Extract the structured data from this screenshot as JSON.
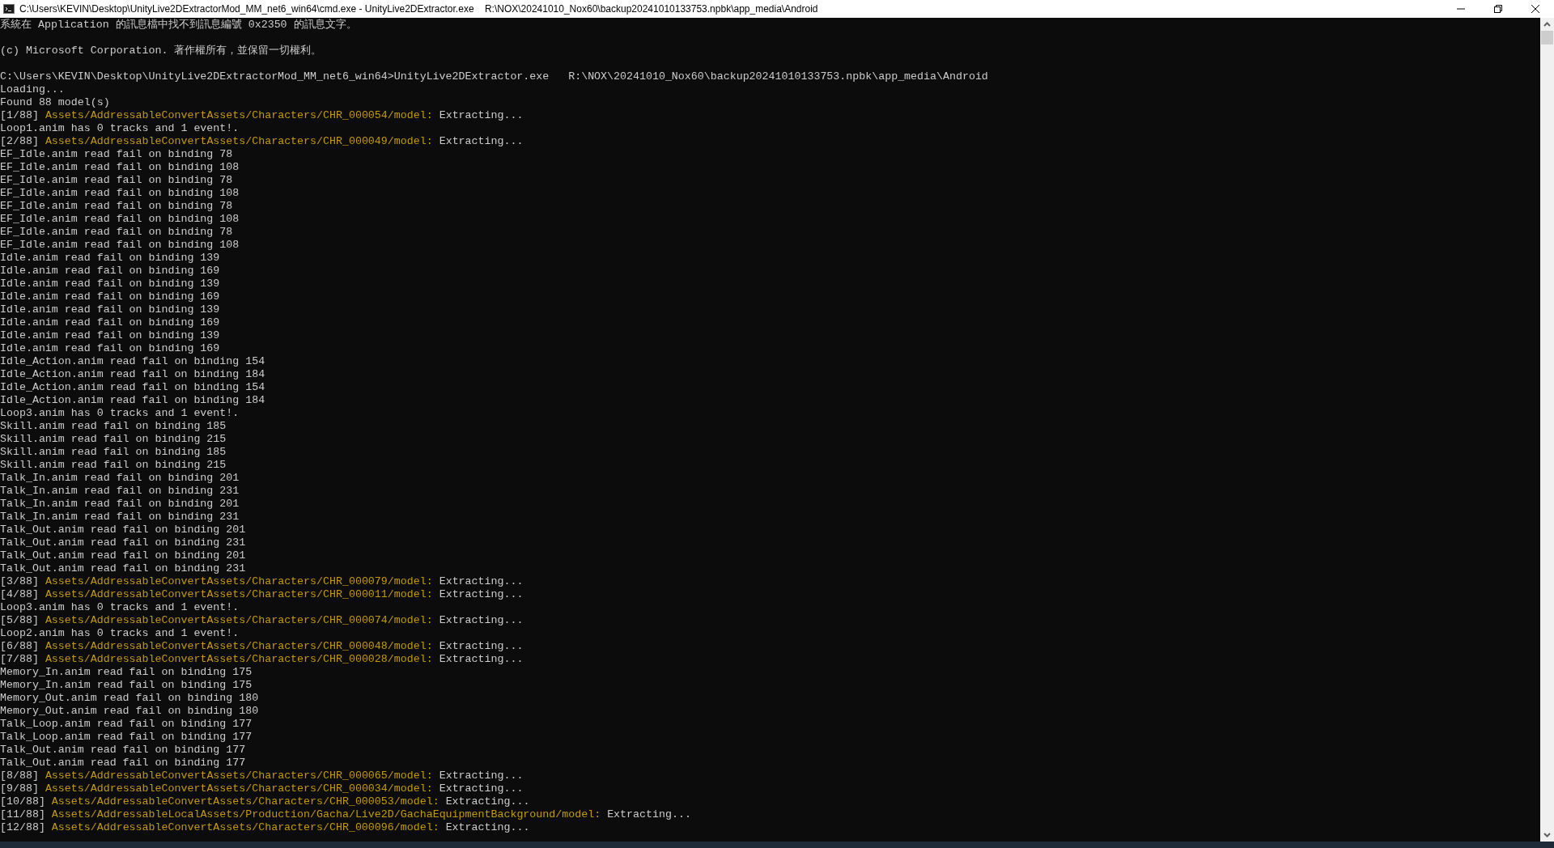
{
  "window": {
    "title": "C:\\Users\\KEVIN\\Desktop\\UnityLive2DExtractorMod_MM_net6_win64\\cmd.exe - UnityLive2DExtractor.exe    R:\\NOX\\20241010_Nox60\\backup20241010133753.npbk\\app_media\\Android"
  },
  "console": {
    "lines": [
      {
        "kind": "text",
        "text": "系統在 Application 的訊息檔中找不到訊息編號 0x2350 的訊息文字。"
      },
      {
        "kind": "blank"
      },
      {
        "kind": "text",
        "text": "(c) Microsoft Corporation. 著作權所有，並保留一切權利。"
      },
      {
        "kind": "blank"
      },
      {
        "kind": "text",
        "text": "C:\\Users\\KEVIN\\Desktop\\UnityLive2DExtractorMod_MM_net6_win64>UnityLive2DExtractor.exe   R:\\NOX\\20241010_Nox60\\backup20241010133753.npbk\\app_media\\Android"
      },
      {
        "kind": "text",
        "text": "Loading..."
      },
      {
        "kind": "text",
        "text": "Found 88 model(s)"
      },
      {
        "kind": "progress",
        "counter": "[1/88]",
        "path": "Assets/AddressableConvertAssets/Characters/CHR_000054/model:",
        "status": "Extracting..."
      },
      {
        "kind": "text",
        "text": "Loop1.anim has 0 tracks and 1 event!."
      },
      {
        "kind": "progress",
        "counter": "[2/88]",
        "path": "Assets/AddressableConvertAssets/Characters/CHR_000049/model:",
        "status": "Extracting..."
      },
      {
        "kind": "text",
        "text": "EF_Idle.anim read fail on binding 78"
      },
      {
        "kind": "text",
        "text": "EF_Idle.anim read fail on binding 108"
      },
      {
        "kind": "text",
        "text": "EF_Idle.anim read fail on binding 78"
      },
      {
        "kind": "text",
        "text": "EF_Idle.anim read fail on binding 108"
      },
      {
        "kind": "text",
        "text": "EF_Idle.anim read fail on binding 78"
      },
      {
        "kind": "text",
        "text": "EF_Idle.anim read fail on binding 108"
      },
      {
        "kind": "text",
        "text": "EF_Idle.anim read fail on binding 78"
      },
      {
        "kind": "text",
        "text": "EF_Idle.anim read fail on binding 108"
      },
      {
        "kind": "text",
        "text": "Idle.anim read fail on binding 139"
      },
      {
        "kind": "text",
        "text": "Idle.anim read fail on binding 169"
      },
      {
        "kind": "text",
        "text": "Idle.anim read fail on binding 139"
      },
      {
        "kind": "text",
        "text": "Idle.anim read fail on binding 169"
      },
      {
        "kind": "text",
        "text": "Idle.anim read fail on binding 139"
      },
      {
        "kind": "text",
        "text": "Idle.anim read fail on binding 169"
      },
      {
        "kind": "text",
        "text": "Idle.anim read fail on binding 139"
      },
      {
        "kind": "text",
        "text": "Idle.anim read fail on binding 169"
      },
      {
        "kind": "text",
        "text": "Idle_Action.anim read fail on binding 154"
      },
      {
        "kind": "text",
        "text": "Idle_Action.anim read fail on binding 184"
      },
      {
        "kind": "text",
        "text": "Idle_Action.anim read fail on binding 154"
      },
      {
        "kind": "text",
        "text": "Idle_Action.anim read fail on binding 184"
      },
      {
        "kind": "text",
        "text": "Loop3.anim has 0 tracks and 1 event!."
      },
      {
        "kind": "text",
        "text": "Skill.anim read fail on binding 185"
      },
      {
        "kind": "text",
        "text": "Skill.anim read fail on binding 215"
      },
      {
        "kind": "text",
        "text": "Skill.anim read fail on binding 185"
      },
      {
        "kind": "text",
        "text": "Skill.anim read fail on binding 215"
      },
      {
        "kind": "text",
        "text": "Talk_In.anim read fail on binding 201"
      },
      {
        "kind": "text",
        "text": "Talk_In.anim read fail on binding 231"
      },
      {
        "kind": "text",
        "text": "Talk_In.anim read fail on binding 201"
      },
      {
        "kind": "text",
        "text": "Talk_In.anim read fail on binding 231"
      },
      {
        "kind": "text",
        "text": "Talk_Out.anim read fail on binding 201"
      },
      {
        "kind": "text",
        "text": "Talk_Out.anim read fail on binding 231"
      },
      {
        "kind": "text",
        "text": "Talk_Out.anim read fail on binding 201"
      },
      {
        "kind": "text",
        "text": "Talk_Out.anim read fail on binding 231"
      },
      {
        "kind": "progress",
        "counter": "[3/88]",
        "path": "Assets/AddressableConvertAssets/Characters/CHR_000079/model:",
        "status": "Extracting..."
      },
      {
        "kind": "progress",
        "counter": "[4/88]",
        "path": "Assets/AddressableConvertAssets/Characters/CHR_000011/model:",
        "status": "Extracting..."
      },
      {
        "kind": "text",
        "text": "Loop3.anim has 0 tracks and 1 event!."
      },
      {
        "kind": "progress",
        "counter": "[5/88]",
        "path": "Assets/AddressableConvertAssets/Characters/CHR_000074/model:",
        "status": "Extracting..."
      },
      {
        "kind": "text",
        "text": "Loop2.anim has 0 tracks and 1 event!."
      },
      {
        "kind": "progress",
        "counter": "[6/88]",
        "path": "Assets/AddressableConvertAssets/Characters/CHR_000048/model:",
        "status": "Extracting..."
      },
      {
        "kind": "progress",
        "counter": "[7/88]",
        "path": "Assets/AddressableConvertAssets/Characters/CHR_000028/model:",
        "status": "Extracting..."
      },
      {
        "kind": "text",
        "text": "Memory_In.anim read fail on binding 175"
      },
      {
        "kind": "text",
        "text": "Memory_In.anim read fail on binding 175"
      },
      {
        "kind": "text",
        "text": "Memory_Out.anim read fail on binding 180"
      },
      {
        "kind": "text",
        "text": "Memory_Out.anim read fail on binding 180"
      },
      {
        "kind": "text",
        "text": "Talk_Loop.anim read fail on binding 177"
      },
      {
        "kind": "text",
        "text": "Talk_Loop.anim read fail on binding 177"
      },
      {
        "kind": "text",
        "text": "Talk_Out.anim read fail on binding 177"
      },
      {
        "kind": "text",
        "text": "Talk_Out.anim read fail on binding 177"
      },
      {
        "kind": "progress",
        "counter": "[8/88]",
        "path": "Assets/AddressableConvertAssets/Characters/CHR_000065/model:",
        "status": "Extracting..."
      },
      {
        "kind": "progress",
        "counter": "[9/88]",
        "path": "Assets/AddressableConvertAssets/Characters/CHR_000034/model:",
        "status": "Extracting..."
      },
      {
        "kind": "progress",
        "counter": "[10/88]",
        "path": "Assets/AddressableConvertAssets/Characters/CHR_000053/model:",
        "status": "Extracting..."
      },
      {
        "kind": "progress",
        "counter": "[11/88]",
        "path": "Assets/AddressableLocalAssets/Production/Gacha/Live2D/GachaEquipmentBackground/model:",
        "status": "Extracting..."
      },
      {
        "kind": "progress",
        "counter": "[12/88]",
        "path": "Assets/AddressableConvertAssets/Characters/CHR_000096/model:",
        "status": "Extracting..."
      }
    ]
  }
}
